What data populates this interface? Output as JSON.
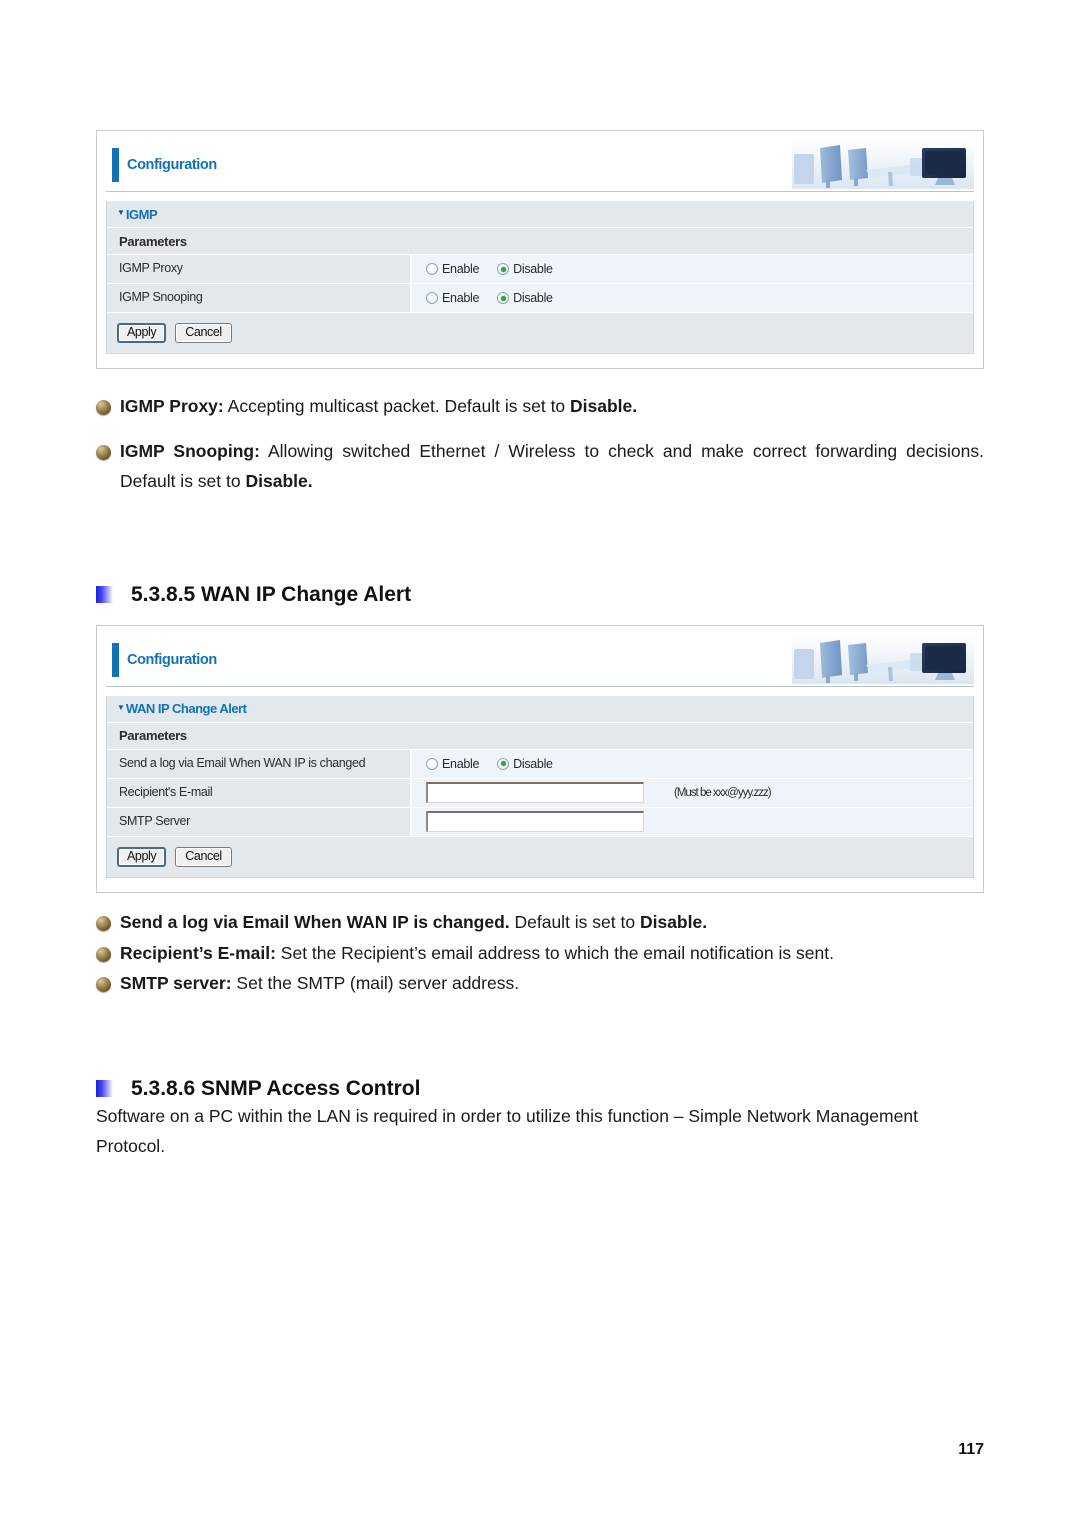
{
  "document": {
    "page_number": "117"
  },
  "panel_igmp": {
    "header_title": "Configuration",
    "header_art": "office-workstation-photo",
    "section_title": "IGMP",
    "params_label": "Parameters",
    "rows": [
      {
        "label": "IGMP Proxy",
        "options": [
          {
            "label": "Enable",
            "checked": false
          },
          {
            "label": "Disable",
            "checked": true
          }
        ]
      },
      {
        "label": "IGMP Snooping",
        "options": [
          {
            "label": "Enable",
            "checked": false
          },
          {
            "label": "Disable",
            "checked": true
          }
        ]
      }
    ],
    "apply_label": "Apply",
    "cancel_label": "Cancel"
  },
  "igmp_notes": {
    "proxy": {
      "term": "IGMP Proxy:",
      "body": " Accepting multicast packet. Default is set to ",
      "emphasis": "Disable."
    },
    "snooping": {
      "term": "IGMP Snooping:",
      "body": " Allowing switched Ethernet / Wireless to check and make correct forwarding decisions. Default is set to ",
      "emphasis": "Disable."
    }
  },
  "heading_wan": {
    "text": "5.3.8.5 WAN IP Change Alert"
  },
  "panel_wan": {
    "header_title": "Configuration",
    "header_art": "office-workstation-photo",
    "section_title": "WAN IP Change Alert",
    "params_label": "Parameters",
    "row_sendlog": {
      "label": "Send a log via Email When WAN IP is changed",
      "options": [
        {
          "label": "Enable",
          "checked": false
        },
        {
          "label": "Disable",
          "checked": true
        }
      ]
    },
    "row_email": {
      "label": "Recipient's E-mail",
      "value": "",
      "placeholder": "",
      "hint": "(Must be xxx@yyy.zzz)"
    },
    "row_smtp": {
      "label": "SMTP Server",
      "value": "",
      "placeholder": ""
    },
    "apply_label": "Apply",
    "cancel_label": "Cancel"
  },
  "wan_notes": {
    "sendlog": {
      "term": "Send a log via Email When WAN IP is changed.",
      "body": " Default is set to ",
      "emphasis": "Disable."
    },
    "recipient": {
      "term": "Recipient’s E-mail:",
      "body": " Set the Recipient’s email address to which the email notification is sent."
    },
    "smtp": {
      "term": "SMTP server:",
      "body": " Set the SMTP (mail) server address."
    }
  },
  "heading_snmp": {
    "text": "5.3.8.6 SNMP Access Control"
  },
  "snmp_notes": {
    "body": "Software on a PC within the LAN is required in order to utilize this function – Simple Network Management Protocol."
  },
  "colors": {
    "brand_blue": "#1272b5",
    "label_bg": "#e3e8ec",
    "value_bg": "#eef4fa",
    "radio_green": "#2fa83a"
  }
}
